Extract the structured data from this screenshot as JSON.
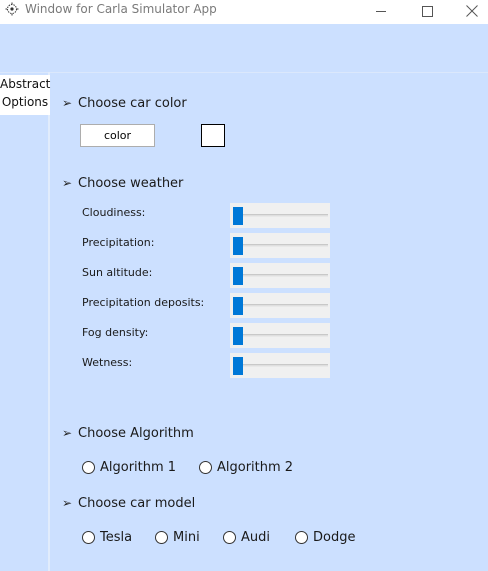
{
  "window": {
    "title": "Window for Carla Simulator App",
    "controls": {
      "minimize_icon": "minimize-icon",
      "maximize_icon": "maximize-icon",
      "close_icon": "close-icon"
    }
  },
  "side_tab": {
    "line1": "Abstract",
    "line2": "Options"
  },
  "sections": {
    "car_color": {
      "arrow": "➢",
      "title": "Choose car color",
      "button_label": "color",
      "swatch_color": "#ffffff"
    },
    "weather": {
      "arrow": "➢",
      "title": "Choose weather",
      "params": [
        {
          "label": "Cloudiness:",
          "value": 0
        },
        {
          "label": "Precipitation:",
          "value": 0
        },
        {
          "label": "Sun altitude:",
          "value": 0
        },
        {
          "label": "Precipitation deposits:",
          "value": 0
        },
        {
          "label": "Fog density:",
          "value": 0
        },
        {
          "label": "Wetness:",
          "value": 0
        }
      ]
    },
    "algorithm": {
      "arrow": "➢",
      "title": "Choose Algorithm",
      "options": [
        "Algorithm 1",
        "Algorithm 2"
      ]
    },
    "car_model": {
      "arrow": "➢",
      "title": "Choose car model",
      "options": [
        "Tesla",
        "Mini",
        "Audi",
        "Dodge"
      ]
    }
  },
  "colors": {
    "background": "#cce0ff",
    "slider_thumb": "#0078d7",
    "slider_bg": "#f0f0f0"
  }
}
